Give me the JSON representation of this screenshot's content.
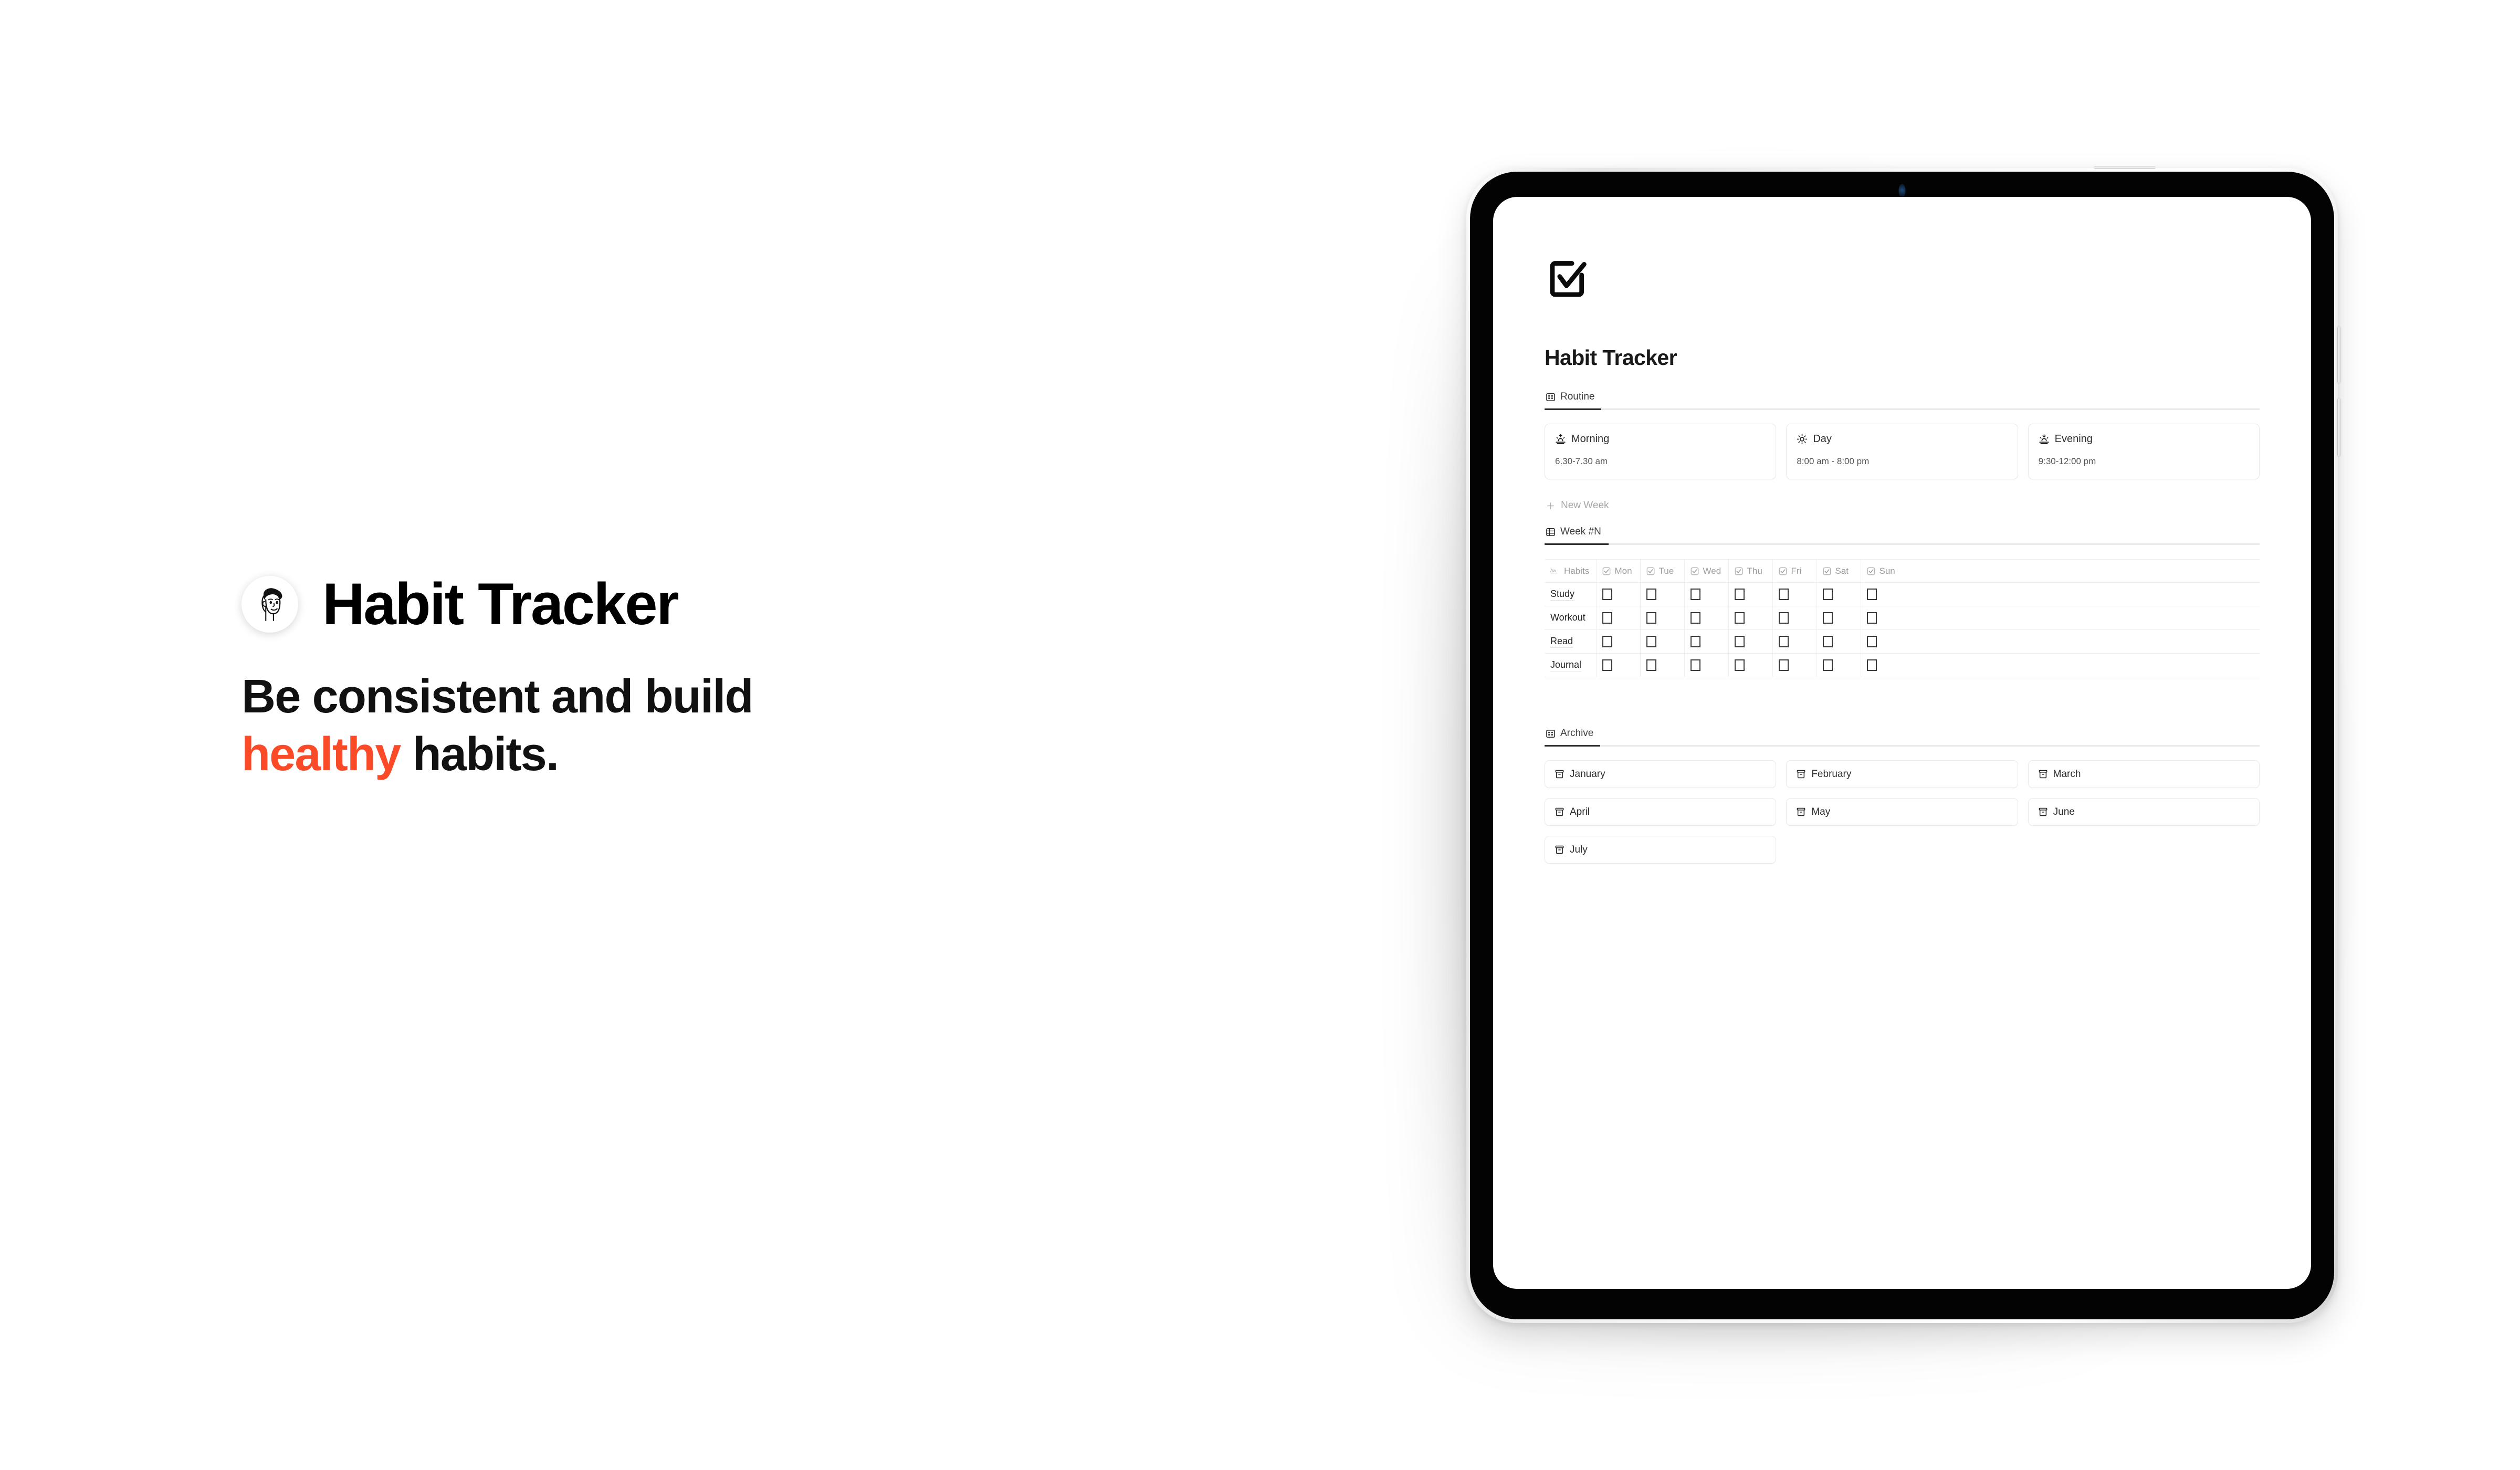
{
  "promo": {
    "avatar_icon": "person-face-avatar-icon",
    "title": "Habit Tracker",
    "subtitle_line1": "Be consistent and build",
    "subtitle_accent": "healthy",
    "subtitle_tail": " habits.",
    "accent_color": "#FA4A28"
  },
  "device": {
    "type": "tablet",
    "camera_icon": "front-camera-icon",
    "power_button": "power-button",
    "volume_up_button": "volume-up-button",
    "volume_down_button": "volume-down-button"
  },
  "app": {
    "page_icon": "checkbox-check-icon",
    "page_title": "Habit Tracker",
    "routine": {
      "tab_label": "Routine",
      "tab_icon": "table-grid-icon",
      "cards": [
        {
          "icon": "sunrise-icon",
          "title": "Morning",
          "time": "6.30-7.30 am"
        },
        {
          "icon": "sun-icon",
          "title": "Day",
          "time": "8:00 am - 8:00 pm"
        },
        {
          "icon": "sunset-icon",
          "title": "Evening",
          "time": "9:30-12:00 pm"
        }
      ]
    },
    "new_week": {
      "label": "New Week",
      "icon": "plus-icon"
    },
    "week": {
      "tab_label": "Week #N",
      "tab_icon": "table-grid-icon",
      "columns": [
        {
          "label": "Habits",
          "icon": "aa-text-icon"
        },
        {
          "label": "Mon",
          "icon": "checkbox-checked-icon"
        },
        {
          "label": "Tue",
          "icon": "checkbox-checked-icon"
        },
        {
          "label": "Wed",
          "icon": "checkbox-checked-icon"
        },
        {
          "label": "Thu",
          "icon": "checkbox-checked-icon"
        },
        {
          "label": "Fri",
          "icon": "checkbox-checked-icon"
        },
        {
          "label": "Sat",
          "icon": "checkbox-checked-icon"
        },
        {
          "label": "Sun",
          "icon": "checkbox-checked-icon"
        }
      ],
      "rows": [
        {
          "habit": "Study",
          "checks": [
            false,
            false,
            false,
            false,
            false,
            false,
            false
          ]
        },
        {
          "habit": "Workout",
          "checks": [
            false,
            false,
            false,
            false,
            false,
            false,
            false
          ]
        },
        {
          "habit": "Read",
          "checks": [
            false,
            false,
            false,
            false,
            false,
            false,
            false
          ]
        },
        {
          "habit": "Journal",
          "checks": [
            false,
            false,
            false,
            false,
            false,
            false,
            false
          ]
        }
      ]
    },
    "archive": {
      "tab_label": "Archive",
      "tab_icon": "table-grid-icon",
      "item_icon": "archive-box-icon",
      "items": [
        "January",
        "February",
        "March",
        "April",
        "May",
        "June",
        "July"
      ]
    }
  }
}
